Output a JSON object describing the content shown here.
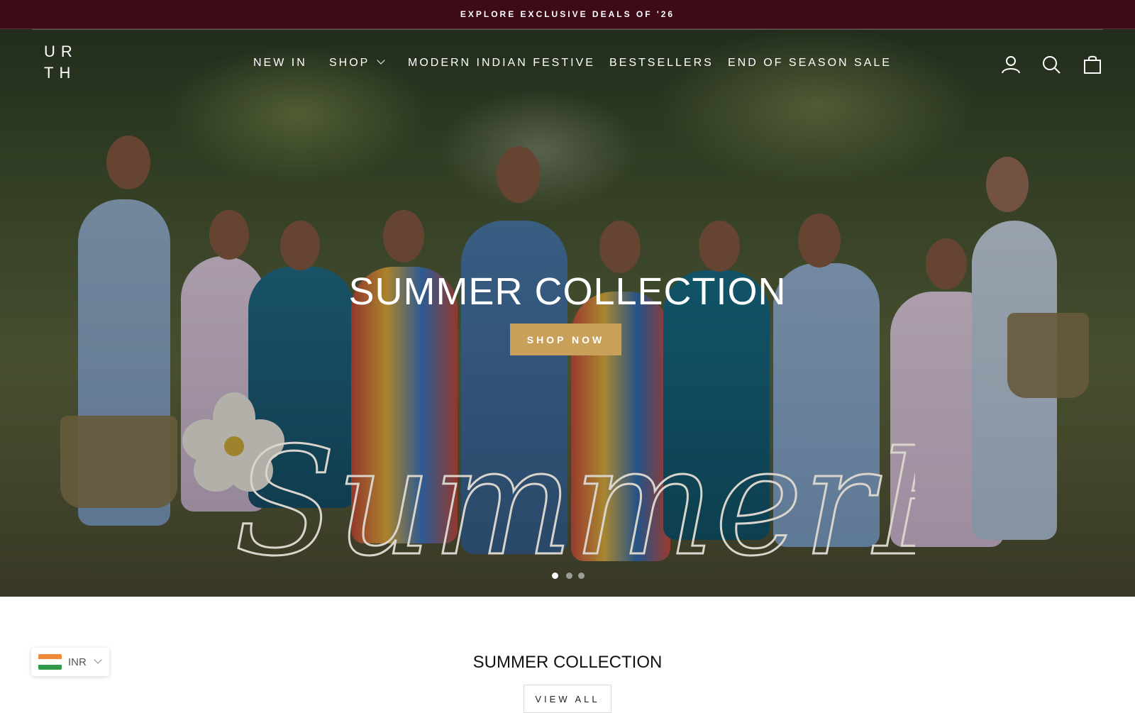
{
  "announcement": {
    "text": "EXPLORE EXCLUSIVE DEALS OF '26"
  },
  "header": {
    "logo": {
      "line1": "UR",
      "line2": "TH"
    },
    "nav": [
      {
        "label": "NEW IN"
      },
      {
        "label": "SHOP",
        "has_dropdown": true
      },
      {
        "label": "MODERN INDIAN FESTIVE"
      },
      {
        "label": "BESTSELLERS"
      },
      {
        "label": "END OF SEASON SALE"
      }
    ],
    "icons": [
      "account-icon",
      "search-icon",
      "cart-icon"
    ]
  },
  "hero": {
    "title": "SUMMER COLLECTION",
    "button_label": "SHOP NOW",
    "script_text": "SummerBloom",
    "slides": {
      "count": 3,
      "active": 1
    }
  },
  "section": {
    "title": "SUMMER COLLECTION",
    "button_label": "VIEW ALL"
  },
  "currency": {
    "code": "INR"
  },
  "colors": {
    "announcement_bg": "#3d0a18",
    "accent_button": "#c9a05a"
  }
}
